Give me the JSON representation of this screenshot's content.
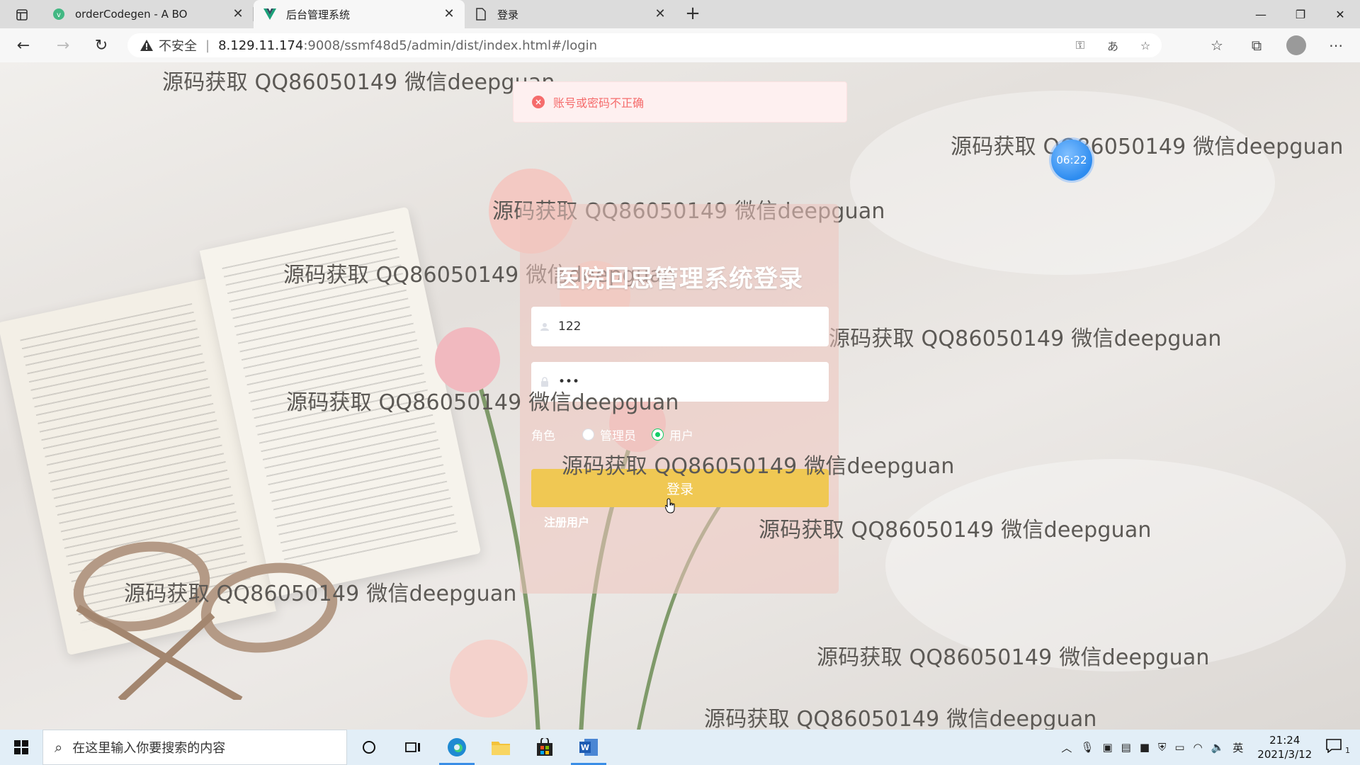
{
  "browser": {
    "tabs": [
      {
        "title": "orderCodegen - A BO",
        "active": false
      },
      {
        "title": "后台管理系统",
        "active": true
      },
      {
        "title": "登录",
        "active": false
      }
    ],
    "new_tab": "+",
    "address": {
      "security_label": "不安全",
      "separator": "|",
      "url_host": "8.129.11.174",
      "url_rest": ":9008/ssmf48d5/admin/dist/index.html#/login"
    }
  },
  "page": {
    "toast": {
      "icon": "×",
      "message": "账号或密码不正确"
    },
    "timer": "06:22",
    "login": {
      "title": "医院回忌管理系统登录",
      "username_value": "122",
      "password_value": "•••",
      "role_label": "角色",
      "roles": [
        {
          "label": "管理员",
          "checked": false
        },
        {
          "label": "用户",
          "checked": true
        }
      ],
      "login_button": "登录",
      "register_link": "注册用户"
    },
    "watermark_text": "源码获取 QQ86050149 微信deepguan"
  },
  "taskbar": {
    "search_placeholder": "在这里输入你要搜索的内容",
    "ime": "英",
    "clock_time": "21:24",
    "clock_date": "2021/3/12",
    "notification_count": "1"
  },
  "colors": {
    "toast_text": "#f56c6c",
    "login_button": "#f0c853",
    "radio_checked": "#13ce66"
  }
}
